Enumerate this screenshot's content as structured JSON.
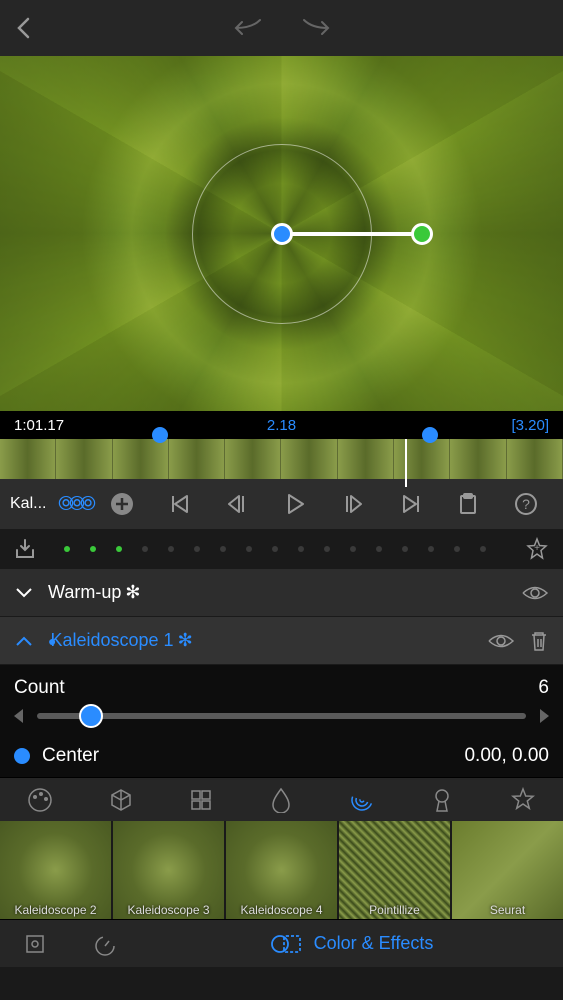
{
  "timecode": {
    "left": "1:01.17",
    "mid": "2.18",
    "right": "[3.20]"
  },
  "controls_label": "Kal...",
  "effects": [
    {
      "name": "Warm-up",
      "ast": "✻"
    },
    {
      "name": "Kaleidoscope 1",
      "ast": "✻"
    }
  ],
  "param_count": {
    "label": "Count",
    "value": "6"
  },
  "param_center": {
    "label": "Center",
    "value": "0.00, 0.00"
  },
  "presets": [
    {
      "label": "Kaleidoscope 2"
    },
    {
      "label": "Kaleidoscope 3"
    },
    {
      "label": "Kaleidoscope 4"
    },
    {
      "label": "Pointillize"
    },
    {
      "label": "Seurat"
    }
  ],
  "bottom_label": "Color & Effects"
}
